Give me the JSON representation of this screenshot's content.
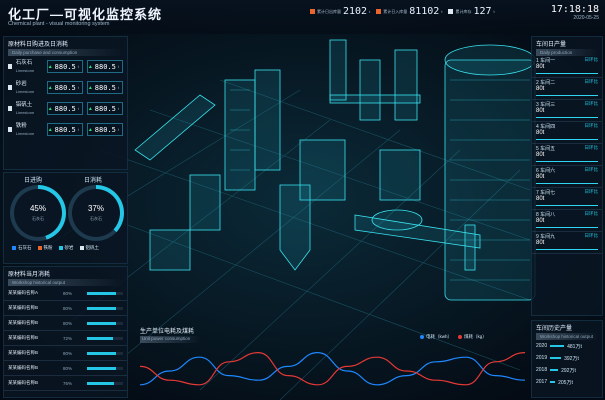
{
  "header": {
    "title": "化工厂—可视化监控系统",
    "subtitle": "Chemical plant - visual monitoring system"
  },
  "stats": [
    {
      "label": "累计日出库量",
      "value": "2102",
      "unit": "t",
      "color": "orange"
    },
    {
      "label": "累计日入库量",
      "value": "81102",
      "unit": "t",
      "color": "orange"
    },
    {
      "label": "累计库存",
      "value": "127",
      "unit": "t",
      "color": "white"
    }
  ],
  "clock": {
    "time": "17:18:18",
    "date": "2020-05-25"
  },
  "materials": {
    "title": "原材料日购进及日消耗",
    "subtitle": "Daily purchase and consumption",
    "items": [
      {
        "name": "石灰石",
        "sub": "Limestone",
        "in": "880.5",
        "out": "880.5",
        "unit": "t"
      },
      {
        "name": "砂岩",
        "sub": "Limestone",
        "in": "880.5",
        "out": "880.5",
        "unit": "t"
      },
      {
        "name": "铝矾土",
        "sub": "Limestone",
        "in": "880.5",
        "out": "880.5",
        "unit": "t"
      },
      {
        "name": "铁粉",
        "sub": "Limestone",
        "in": "880.5",
        "out": "880.5",
        "unit": "t"
      }
    ]
  },
  "gauges": [
    {
      "title": "日进购",
      "percent": 45,
      "value": "45%",
      "label": "石灰石"
    },
    {
      "title": "日消耗",
      "percent": 37,
      "value": "37%",
      "label": "石灰石"
    }
  ],
  "gauge_legend": [
    "石灰石",
    "铁粉",
    "砂岩",
    "铝矾土"
  ],
  "history": {
    "title": "原材料当月消耗",
    "subtitle": "Workshop historical output",
    "rows": [
      {
        "name": "某某编码名称A",
        "pct": "80%",
        "fill": 0.8
      },
      {
        "name": "某某编码名称B",
        "pct": "80%",
        "fill": 0.8
      },
      {
        "name": "某某编码名称B",
        "pct": "80%",
        "fill": 0.8
      },
      {
        "name": "某某编码名称B",
        "pct": "72%",
        "fill": 0.72
      },
      {
        "name": "某某编码名称B",
        "pct": "80%",
        "fill": 0.8
      },
      {
        "name": "某某编码名称B",
        "pct": "80%",
        "fill": 0.8
      },
      {
        "name": "某某编码名称B",
        "pct": "76%",
        "fill": 0.76
      }
    ]
  },
  "production": {
    "title": "车间日产量",
    "subtitle": "Daily production",
    "rows": [
      {
        "idx": "1",
        "name": "车间一",
        "val": "80t",
        "tag": "日环比"
      },
      {
        "idx": "2",
        "name": "车间二",
        "val": "80t",
        "tag": "日环比"
      },
      {
        "idx": "3",
        "name": "车间三",
        "val": "80t",
        "tag": "日环比"
      },
      {
        "idx": "4",
        "name": "车间四",
        "val": "80t",
        "tag": "日环比"
      },
      {
        "idx": "5",
        "name": "车间五",
        "val": "80t",
        "tag": "日环比"
      },
      {
        "idx": "6",
        "name": "车间六",
        "val": "80t",
        "tag": "日环比"
      },
      {
        "idx": "7",
        "name": "车间七",
        "val": "80t",
        "tag": "日环比"
      },
      {
        "idx": "8",
        "name": "车间八",
        "val": "80t",
        "tag": "日环比"
      },
      {
        "idx": "9",
        "name": "车间九",
        "val": "80t",
        "tag": "日环比"
      }
    ]
  },
  "yearly": {
    "title": "车间历史产量",
    "subtitle": "Workshop historical output",
    "rows": [
      {
        "year": "2020",
        "val": "481万t"
      },
      {
        "year": "2019",
        "val": "392万t"
      },
      {
        "year": "2018",
        "val": "292万t"
      },
      {
        "year": "2017",
        "val": "205万t"
      }
    ]
  },
  "chart_data": {
    "type": "line",
    "title": "生产单位电耗及煤耗",
    "subtitle": "Unit power consumption",
    "series": [
      {
        "name": "电耗（kwh）",
        "color": "#1e88ff",
        "values": [
          2,
          5,
          8,
          4,
          3,
          6,
          9,
          5,
          2,
          4,
          7,
          8,
          4,
          3
        ]
      },
      {
        "name": "煤耗（kg）",
        "color": "#e53935",
        "values": [
          6,
          3,
          2,
          7,
          9,
          4,
          2,
          6,
          8,
          5,
          3,
          2,
          7,
          9
        ]
      }
    ]
  },
  "colors": {
    "accent": "#25c7e6",
    "orange": "#e8652b",
    "green": "#27e07a"
  }
}
